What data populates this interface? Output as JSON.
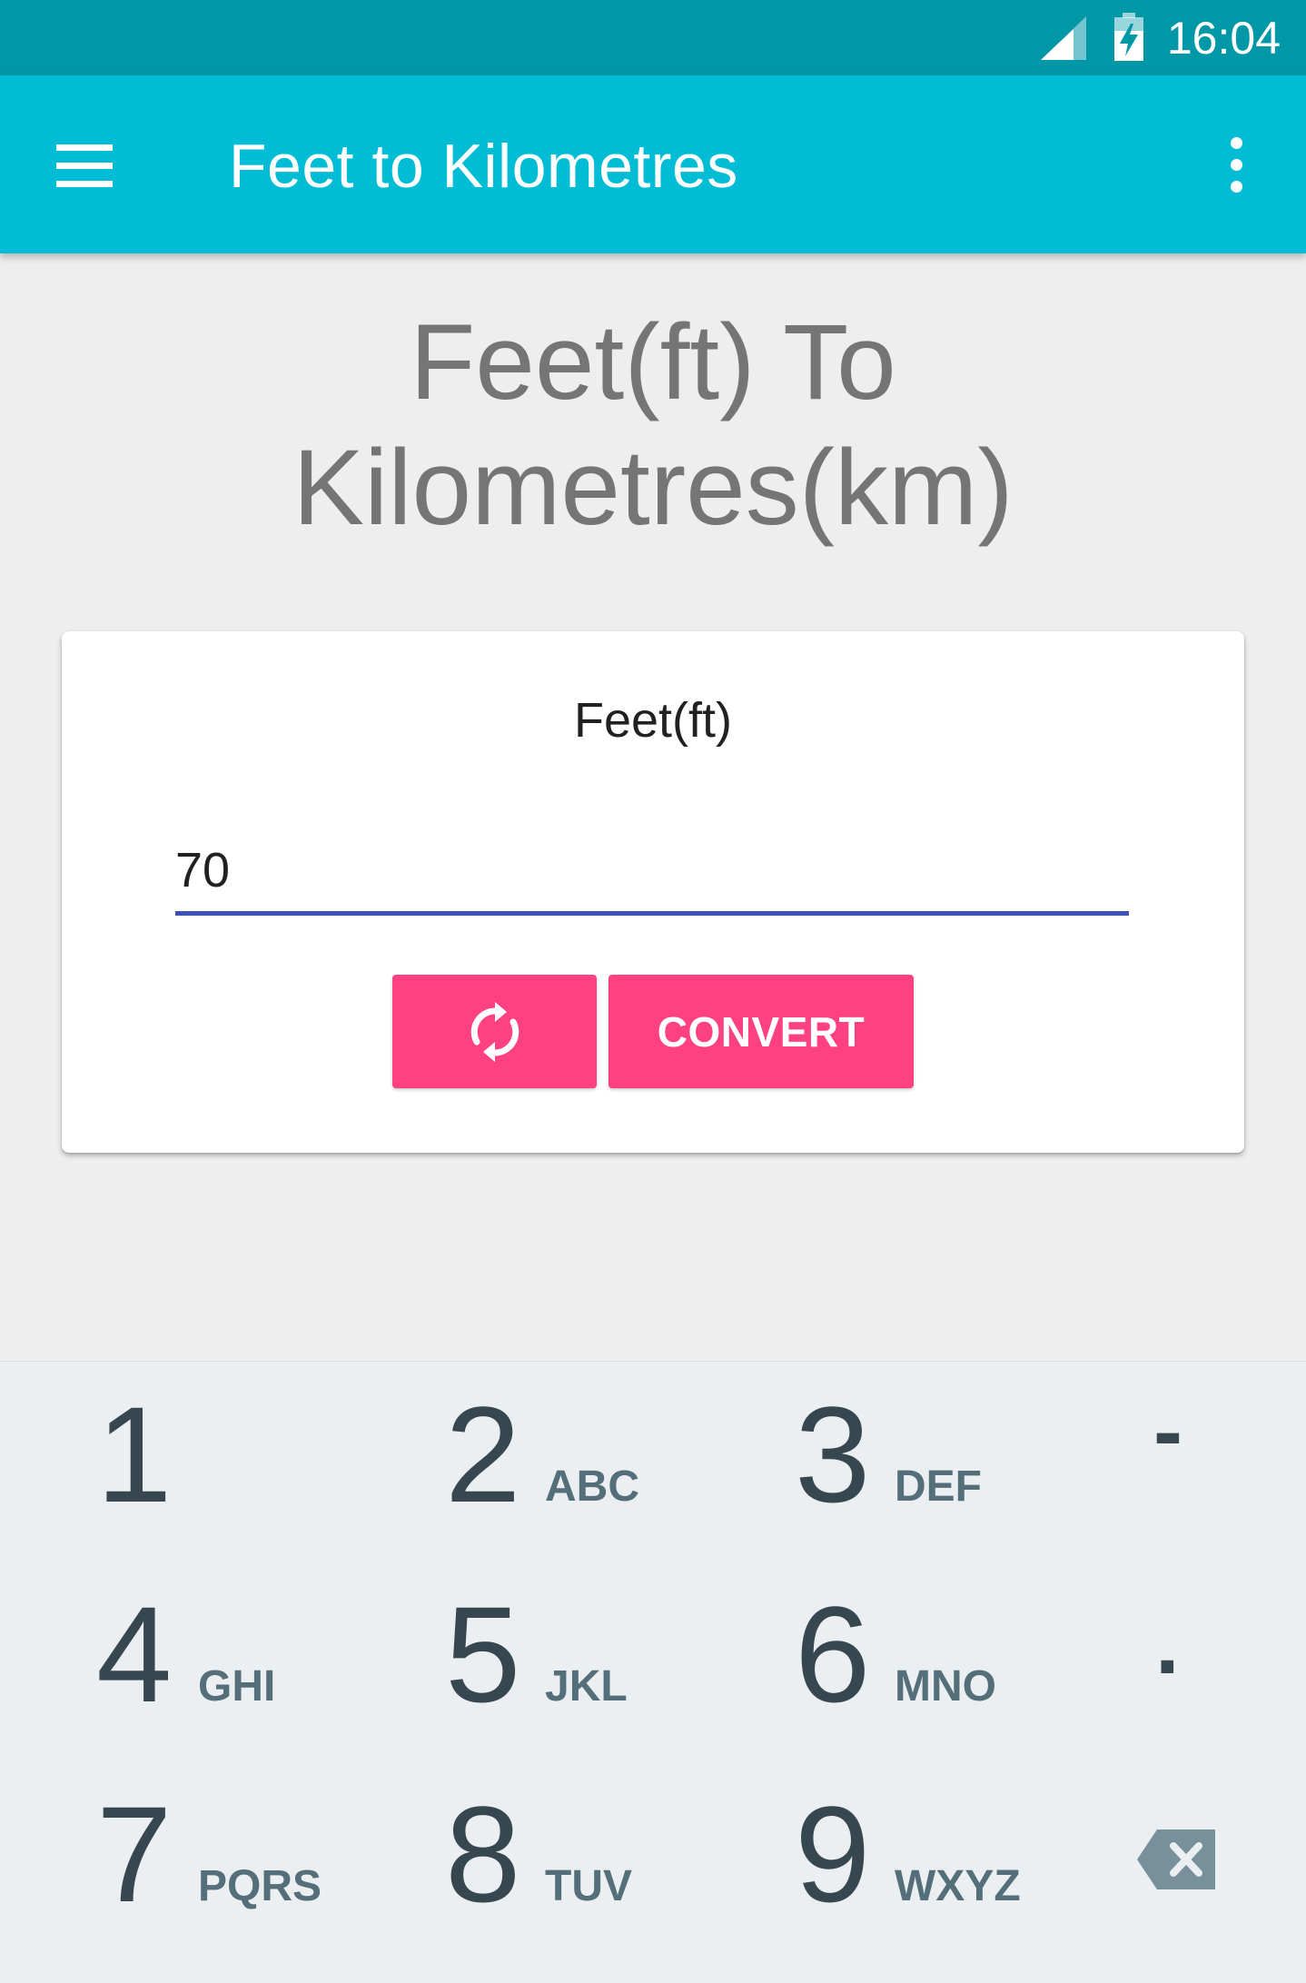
{
  "status_bar": {
    "time": "16:04",
    "signal_icon": "cellular-signal-icon",
    "battery_icon": "battery-charging-icon"
  },
  "app_bar": {
    "title": "Feet to Kilometres",
    "menu_icon": "hamburger-menu-icon",
    "overflow_icon": "more-vert-icon"
  },
  "heading": {
    "line1": "Feet(ft) To",
    "line2": "Kilometres(km)"
  },
  "converter_card": {
    "field_label": "Feet(ft)",
    "input_value": "70",
    "refresh_icon": "refresh-icon",
    "convert_label": "CONVERT"
  },
  "colors": {
    "status_bar": "#0097a7",
    "app_bar": "#00bcd4",
    "accent": "#ff4081",
    "input_underline": "#3f51b5",
    "keyboard_bg": "#eceff1"
  },
  "keyboard": {
    "keys": [
      {
        "num": "1",
        "letters": ""
      },
      {
        "num": "2",
        "letters": "ABC"
      },
      {
        "num": "3",
        "letters": "DEF"
      },
      {
        "num": "4",
        "letters": "GHI"
      },
      {
        "num": "5",
        "letters": "JKL"
      },
      {
        "num": "6",
        "letters": "MNO"
      },
      {
        "num": "7",
        "letters": "PQRS"
      },
      {
        "num": "8",
        "letters": "TUV"
      },
      {
        "num": "9",
        "letters": "WXYZ"
      }
    ],
    "minus": "-",
    "dot": ".",
    "backspace_icon": "backspace-icon"
  }
}
